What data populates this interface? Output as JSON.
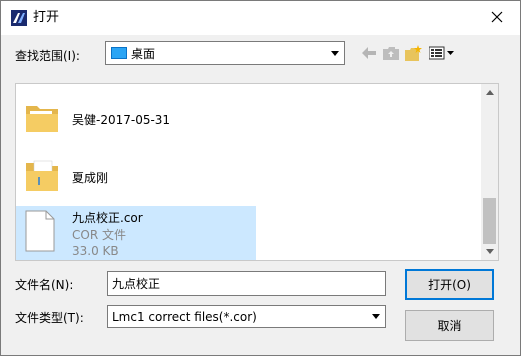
{
  "window": {
    "title": "打开"
  },
  "lookin": {
    "label": "查找范围(I):",
    "value": "桌面"
  },
  "files": [
    {
      "name": "吴健-2017-05-31",
      "icon": "folder-icon"
    },
    {
      "name": "夏成刚",
      "icon": "folder-icon"
    },
    {
      "name": "九点校正.cor",
      "icon": "document-icon",
      "type": "COR 文件",
      "size": "33.0 KB",
      "selected": true
    }
  ],
  "filename": {
    "label": "文件名(N):",
    "value": "九点校正"
  },
  "filetype": {
    "label": "文件类型(T):",
    "value": "Lmc1 correct files(*.cor)"
  },
  "buttons": {
    "open": "打开(O)",
    "cancel": "取消"
  },
  "colors": {
    "selection": "#cce8ff",
    "default_border": "#0078d7"
  }
}
